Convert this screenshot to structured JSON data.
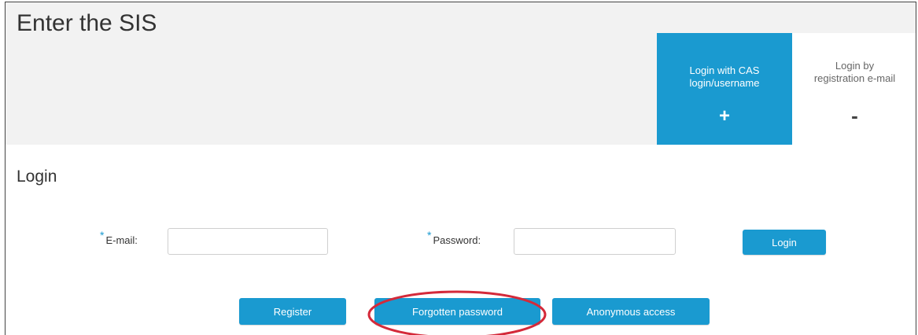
{
  "header": {
    "title": "Enter the SIS",
    "tabs": [
      {
        "label": "Login with CAS login/username",
        "sign": "+"
      },
      {
        "label": "Login by registration e-mail",
        "sign": "-"
      }
    ]
  },
  "login": {
    "title": "Login",
    "required_marker": "*",
    "email_label": "E-mail:",
    "email_value": "",
    "password_label": "Password:",
    "password_value": "",
    "login_button": "Login"
  },
  "actions": {
    "register": "Register",
    "forgotten_password": "Forgotten password",
    "anonymous_access": "Anonymous access"
  },
  "colors": {
    "accent": "#1a9ad0",
    "header_bg": "#f2f2f2",
    "highlight": "#d42a3a"
  }
}
